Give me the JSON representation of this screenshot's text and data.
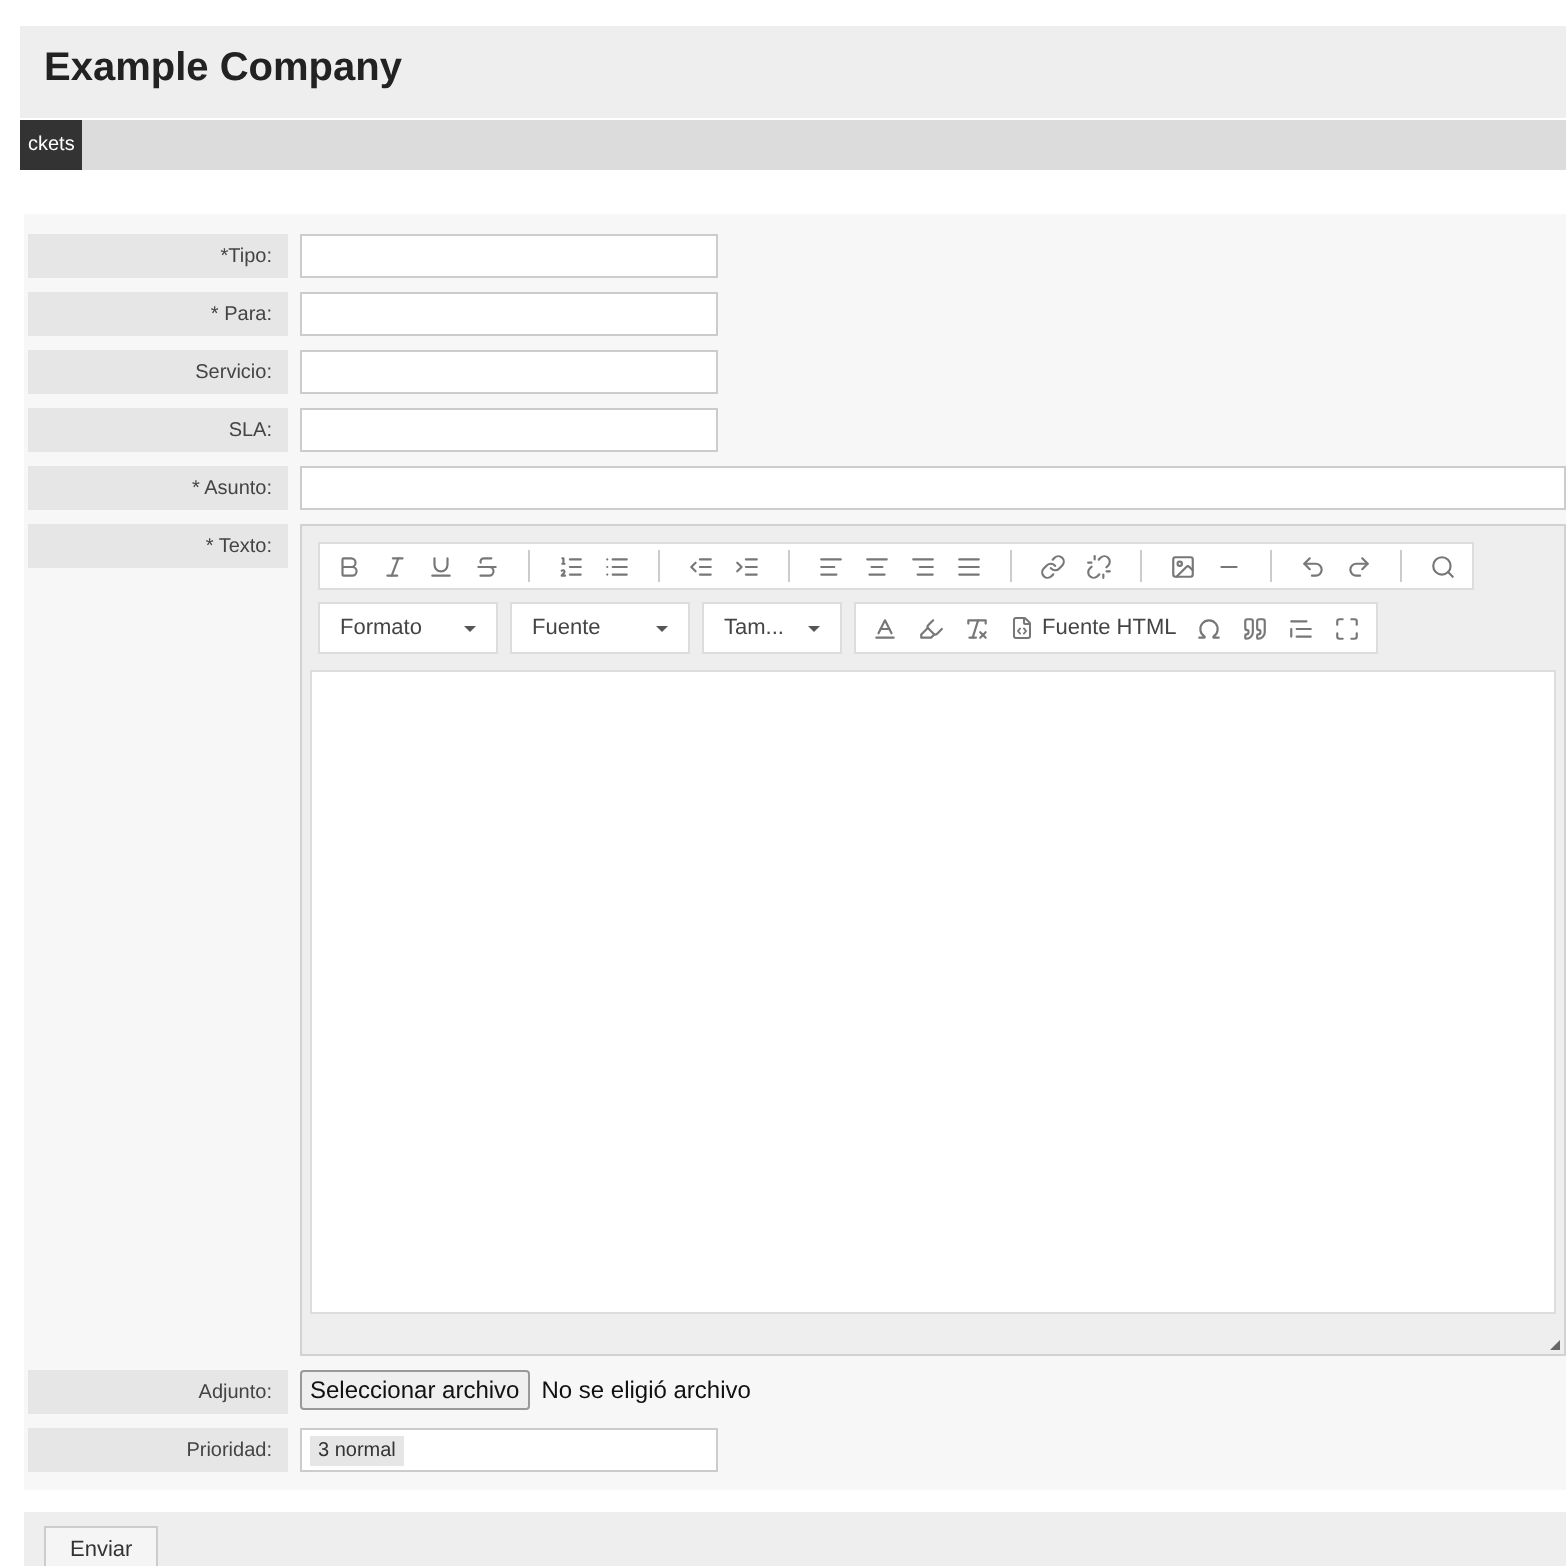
{
  "header": {
    "title": "Example Company"
  },
  "nav": {
    "tabs": [
      {
        "label": "ckets",
        "selected": true
      }
    ]
  },
  "form": {
    "fields": [
      {
        "kind": "text",
        "label": "*Tipo:"
      },
      {
        "kind": "text",
        "label": "* Para:"
      },
      {
        "kind": "text",
        "label": "Servicio:"
      },
      {
        "kind": "text",
        "label": "SLA:"
      },
      {
        "kind": "wide_text",
        "label": "* Asunto:"
      },
      {
        "kind": "editor",
        "label": "* Texto:",
        "dropdowns": [
          "Formato",
          "Fuente",
          "Tam..."
        ],
        "source_button": "Fuente HTML"
      },
      {
        "kind": "file",
        "label": "Adjunto:",
        "button": "Seleccionar archivo",
        "status": "No se eligió archivo"
      },
      {
        "kind": "token",
        "label": "Prioridad:",
        "value": "3 normal"
      }
    ]
  },
  "footer": {
    "submit": "Enviar"
  }
}
